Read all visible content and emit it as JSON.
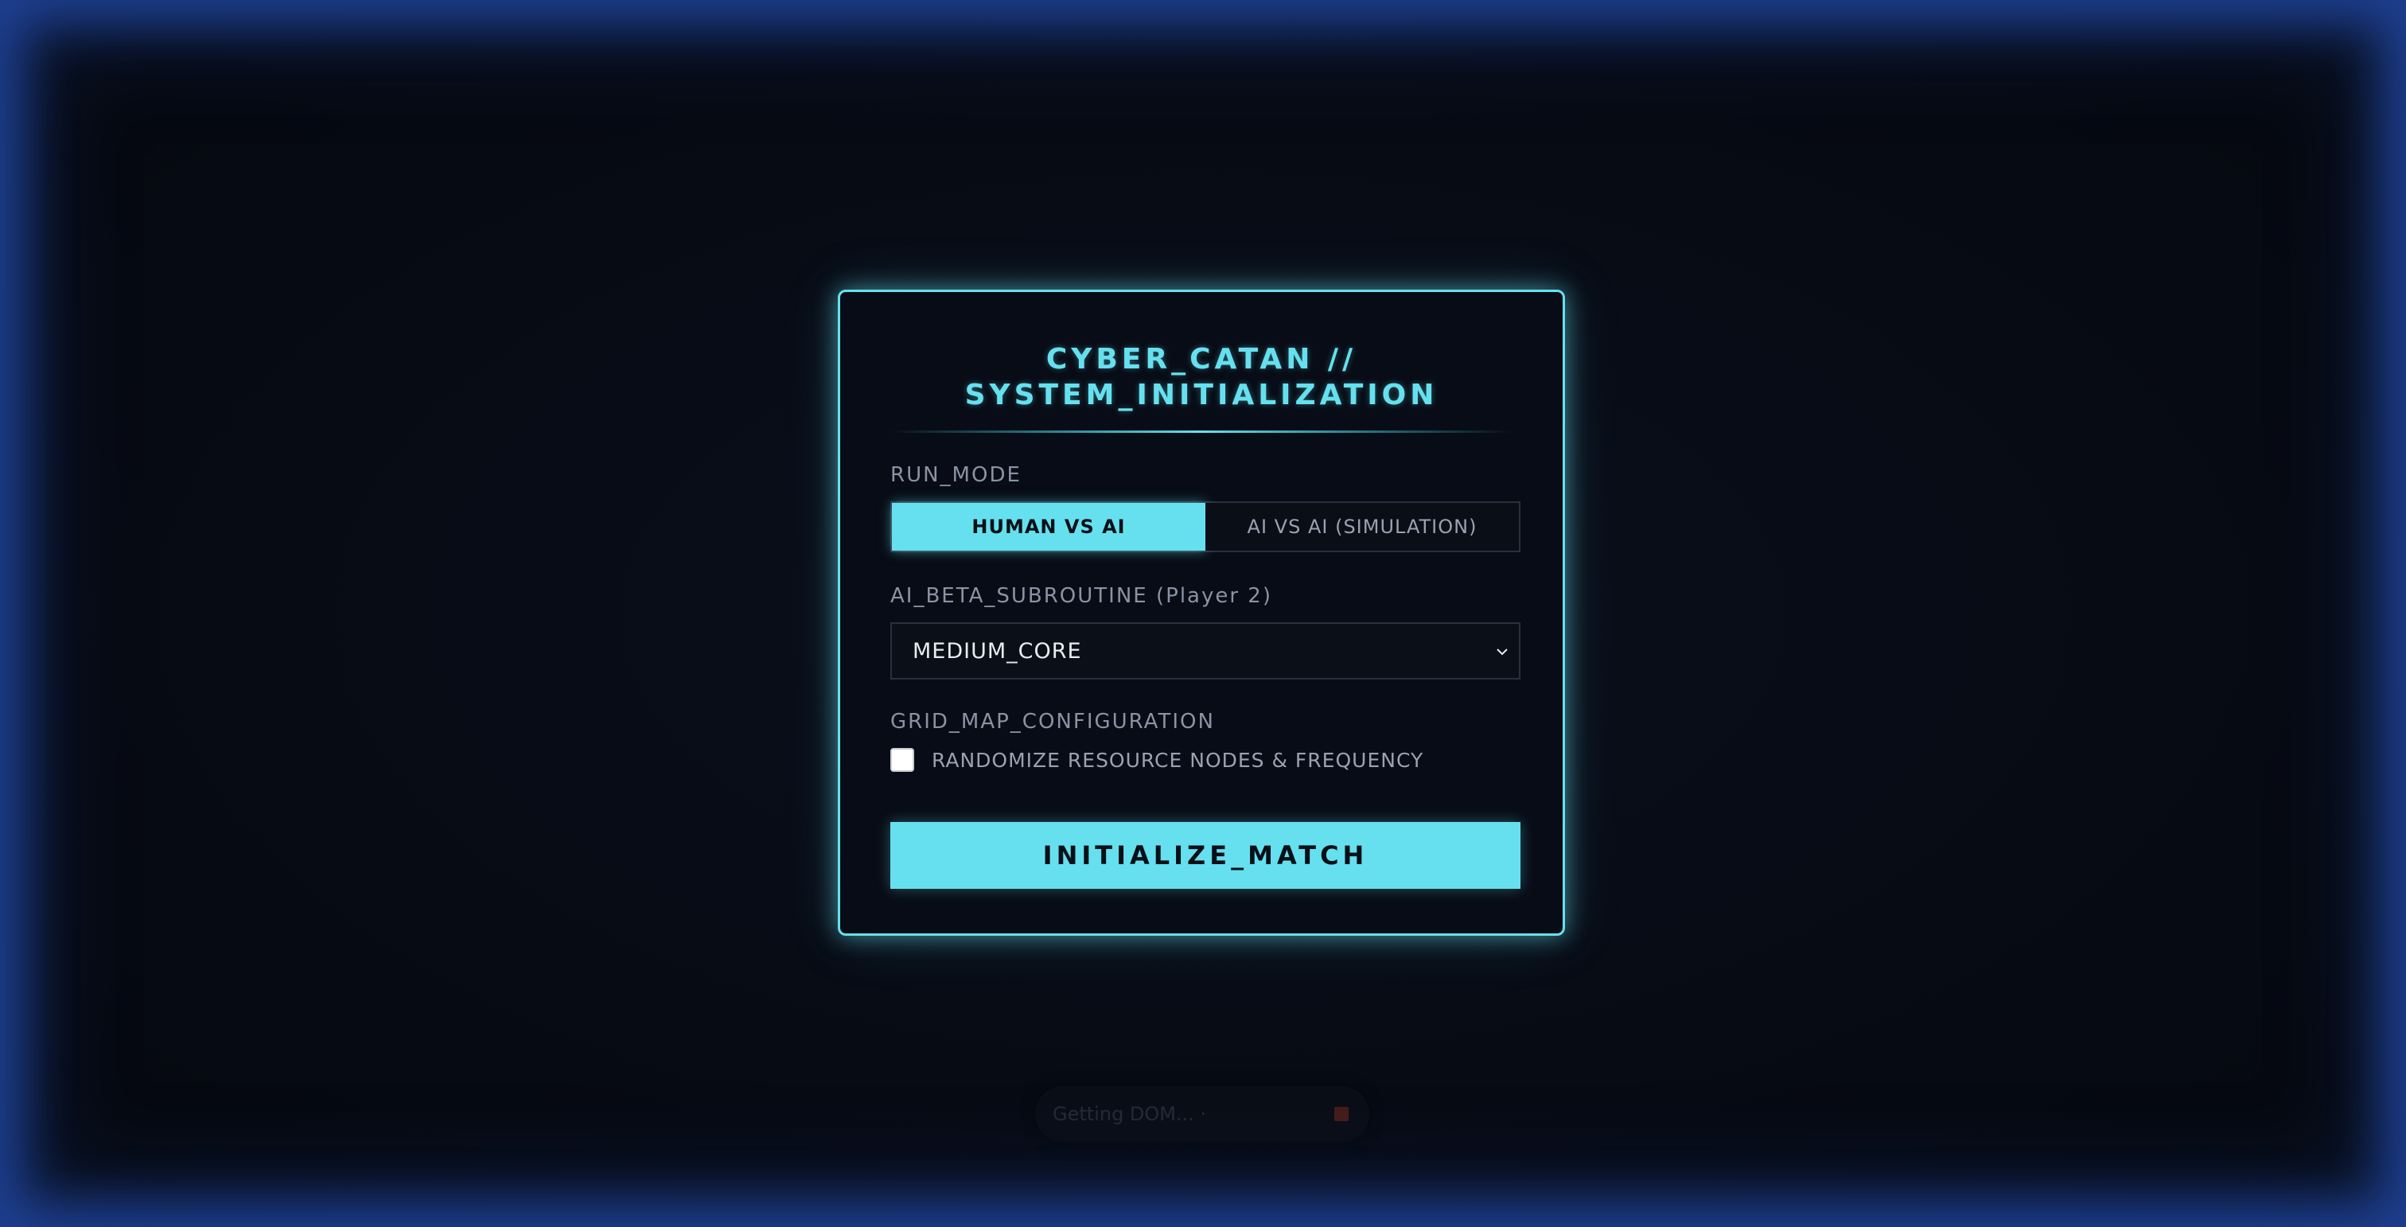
{
  "modal": {
    "title": "CYBER_CATAN //\nSYSTEM_INITIALIZATION",
    "run_mode": {
      "label": "RUN_MODE",
      "options": [
        "HUMAN VS AI",
        "AI VS AI (SIMULATION)"
      ],
      "selected": "HUMAN VS AI"
    },
    "ai_subroutine": {
      "label": "AI_BETA_SUBROUTINE (Player 2)",
      "selected_value": "MEDIUM_CORE",
      "chevron_icon": "chevron-down-icon"
    },
    "grid_config": {
      "label": "GRID_MAP_CONFIGURATION",
      "randomize_label": "RANDOMIZE RESOURCE NODES & FREQUENCY",
      "randomize_checked": false
    },
    "primary_button": "INITIALIZE_MATCH"
  },
  "toast": {
    "text": "Getting DOM... ·",
    "stop_icon": "stop-icon"
  },
  "colors": {
    "accent": "#66e0ee",
    "background": "#080c16",
    "frame": "#3a6bd0"
  }
}
